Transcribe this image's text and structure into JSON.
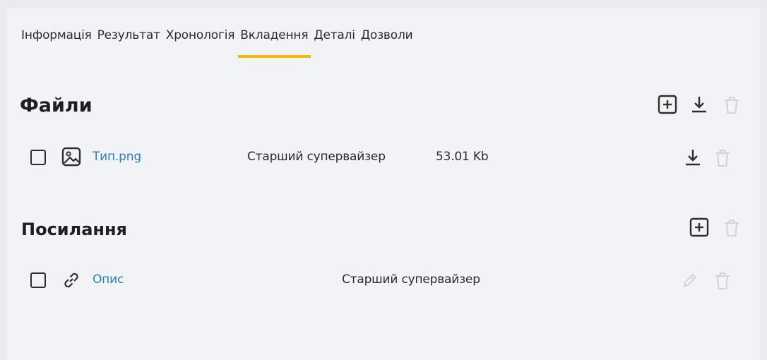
{
  "tabs": [
    {
      "label": "Інформація"
    },
    {
      "label": "Результат"
    },
    {
      "label": "Хронологія"
    },
    {
      "label": "Вкладення"
    },
    {
      "label": "Деталі"
    },
    {
      "label": "Дозволи"
    }
  ],
  "active_tab": "Вкладення",
  "files": {
    "title": "Файли",
    "items": [
      {
        "name": "Тип.png",
        "author": "Старший супервайзер",
        "size": "53.01 Kb"
      }
    ]
  },
  "links": {
    "title": "Посилання",
    "items": [
      {
        "name": "Опис",
        "author": "Старший супервайзер"
      }
    ]
  },
  "colors": {
    "accent": "#f5b800",
    "link": "#2b7fc4",
    "icon_dark": "#2e2e2e",
    "icon_disabled": "#d3d5da"
  },
  "icons": {
    "add": "plus-square-icon",
    "download": "download-icon",
    "delete": "trash-icon",
    "image": "image-icon",
    "link": "link-icon",
    "edit": "pencil-icon"
  }
}
